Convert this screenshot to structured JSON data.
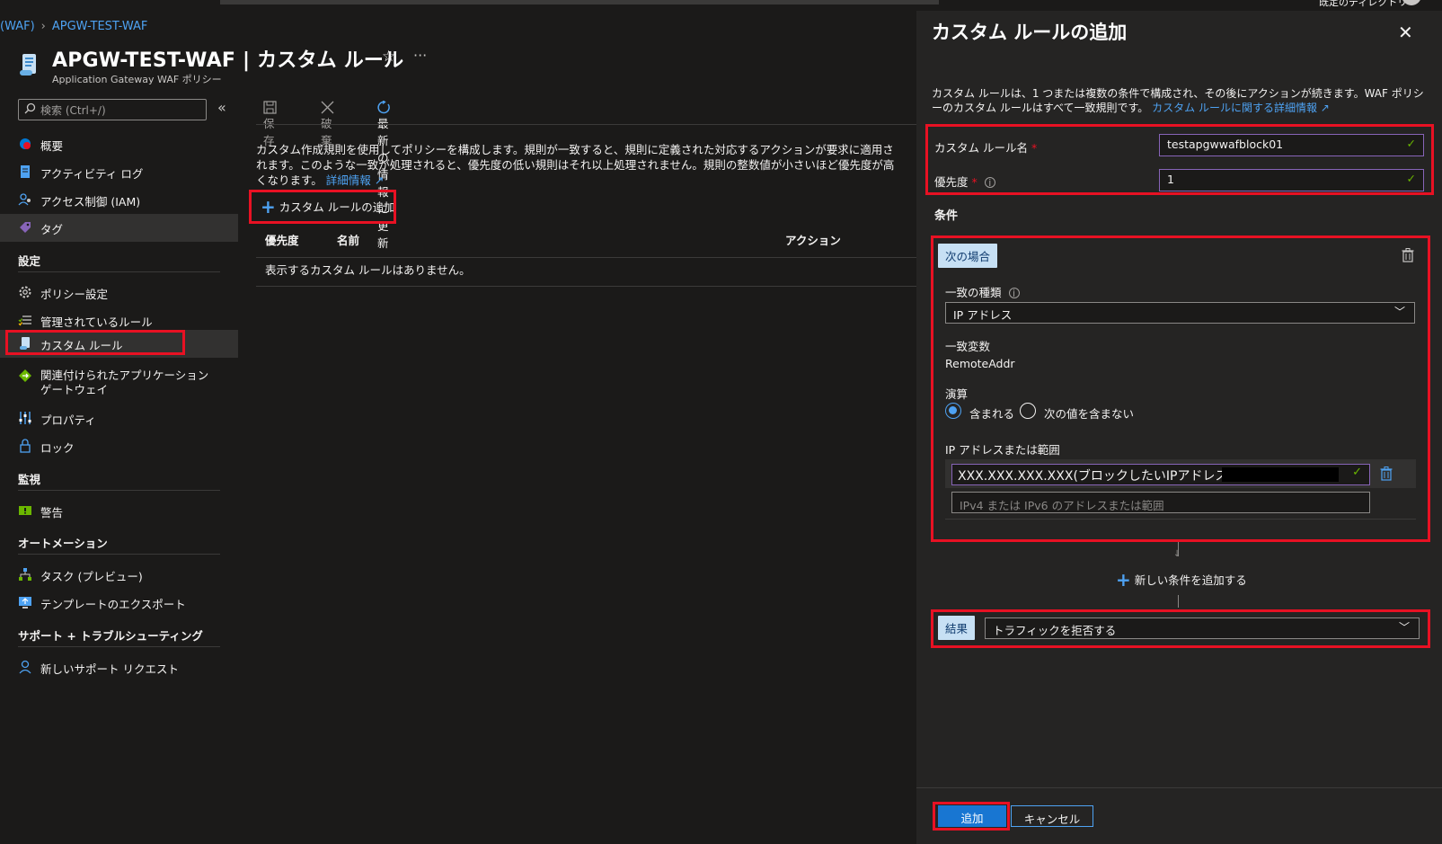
{
  "header": {
    "top_right_text": "既定のディレクトリ",
    "breadcrumb": [
      "(WAF)",
      "APGW-TEST-WAF"
    ],
    "title": "APGW-TEST-WAF | カスタム ルール",
    "subtitle": "Application Gateway WAF ポリシー",
    "star": "☆",
    "ellipsis": "···"
  },
  "sidebar": {
    "search_placeholder": "検索 (Ctrl+/)",
    "collapse": "«",
    "items_top": [
      {
        "label": "概要",
        "icon": "overview-icon"
      },
      {
        "label": "アクティビティ ログ",
        "icon": "activity-log-icon"
      },
      {
        "label": "アクセス制御 (IAM)",
        "icon": "iam-icon"
      },
      {
        "label": "タグ",
        "icon": "tag-icon"
      }
    ],
    "sections": {
      "settings": "設定",
      "monitoring": "監視",
      "automation": "オートメーション",
      "support": "サポート + トラブルシューティング"
    },
    "settings_items": [
      {
        "label": "ポリシー設定",
        "icon": "gear-icon"
      },
      {
        "label": "管理されているルール",
        "icon": "managed-rules-icon"
      },
      {
        "label": "カスタム ルール",
        "icon": "custom-rule-icon"
      },
      {
        "label": "関連付けられたアプリケーション ゲートウェイ",
        "icon": "app-gateway-icon"
      },
      {
        "label": "プロパティ",
        "icon": "properties-icon"
      },
      {
        "label": "ロック",
        "icon": "lock-icon"
      }
    ],
    "monitoring_items": [
      {
        "label": "警告",
        "icon": "alert-icon"
      }
    ],
    "automation_items": [
      {
        "label": "タスク (プレビュー)",
        "icon": "tasks-icon"
      },
      {
        "label": "テンプレートのエクスポート",
        "icon": "export-template-icon"
      }
    ],
    "support_items": [
      {
        "label": "新しいサポート リクエスト",
        "icon": "support-icon"
      }
    ]
  },
  "toolbar": {
    "save": "保存",
    "discard": "破棄",
    "refresh": "最新の情報に更新"
  },
  "main": {
    "description": "カスタム作成規則を使用してポリシーを構成します。規則が一致すると、規則に定義された対応するアクションが要求に適用されます。このような一致が処理されると、優先度の低い規則はそれ以上処理されません。規則の整数値が小さいほど優先度が高くなります。",
    "learn_more": "詳細情報",
    "add_custom_rule": "カスタム ルールの追加",
    "columns": [
      "優先度",
      "名前",
      "アクション"
    ],
    "empty_message": "表示するカスタム ルールはありません。"
  },
  "panel": {
    "title": "カスタム ルールの追加",
    "close": "✕",
    "description": "カスタム ルールは、1 つまたは複数の条件で構成され、その後にアクションが続きます。WAF ポリシーのカスタム ルールはすべて一致規則です。",
    "description_link": "カスタム ルールに関する詳細情報",
    "rule_name_label": "カスタム ルール名",
    "rule_name_value": "testapgwwafblock01",
    "priority_label": "優先度",
    "priority_value": "1",
    "conditions_heading": "条件",
    "if_badge": "次の場合",
    "match_type_label": "一致の種類",
    "match_type_value": "IP アドレス",
    "match_variable_label": "一致変数",
    "match_variable_value": "RemoteAddr",
    "operation_label": "演算",
    "operation_options": [
      "含まれる",
      "次の値を含まない"
    ],
    "operation_selected": 0,
    "ip_label": "IP アドレスまたは範囲",
    "ip_value": "XXX.XXX.XXX.XXX(ブロックしたいIPアドレス)",
    "ip_placeholder": "IPv4 または IPv6 のアドレスまたは範囲",
    "add_condition": "新しい条件を追加する",
    "result_badge": "結果",
    "result_value": "トラフィックを拒否する",
    "add_button": "追加",
    "cancel_button": "キャンセル"
  },
  "colors": {
    "background": "#1b1a19",
    "panel": "#252423",
    "accent": "#4ea2f2",
    "highlight_box": "#e81123",
    "valid": "#6bb700"
  }
}
